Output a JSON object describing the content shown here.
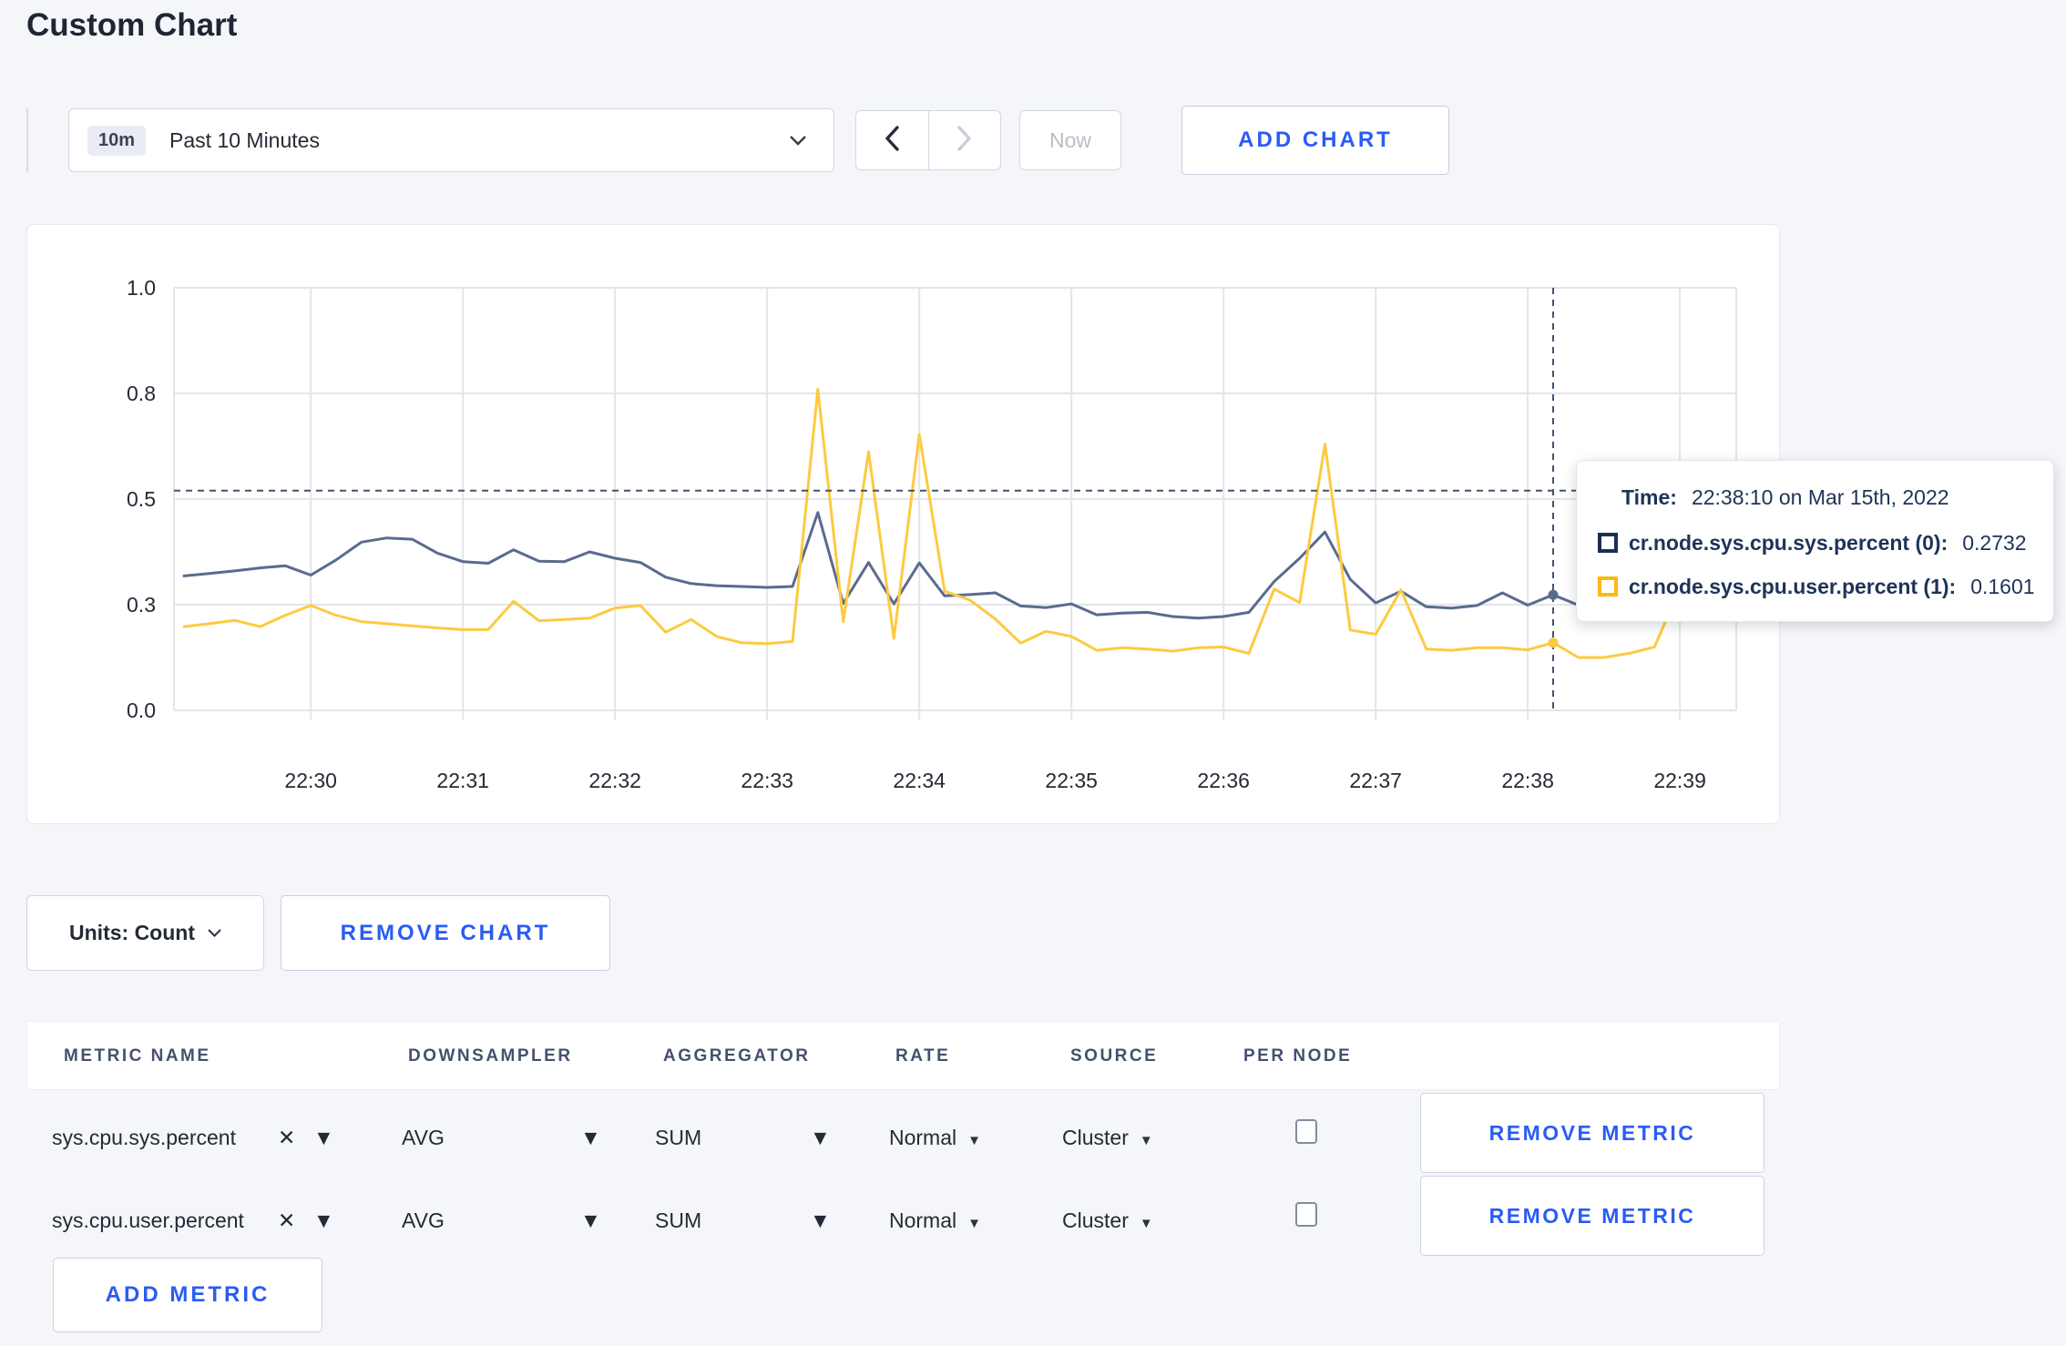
{
  "page": {
    "title": "Custom Chart",
    "background": "#f5f6fa",
    "accent_blue": "#2a5cf4"
  },
  "toolbar": {
    "time_range": {
      "badge": "10m",
      "label": "Past 10 Minutes"
    },
    "now_label": "Now",
    "add_chart_label": "ADD CHART"
  },
  "icons": {
    "close": "✕",
    "caret_down": "▼"
  },
  "chart_data": {
    "type": "line",
    "title": "",
    "xlabel": "",
    "ylabel": "",
    "ylim": [
      0,
      1
    ],
    "grid": true,
    "legend_position": "tooltip",
    "y_tick_values": [
      0,
      0.25,
      0.5,
      0.75,
      1.0
    ],
    "y_tick_labels": [
      "0.0",
      "0.3",
      "0.5",
      "0.8",
      "1.0"
    ],
    "x_tick_labels": [
      "22:30",
      "22:31",
      "22:32",
      "22:33",
      "22:34",
      "22:35",
      "22:36",
      "22:37",
      "22:38",
      "22:39"
    ],
    "x_start": "22:29:10",
    "x_step_seconds": 10,
    "series": [
      {
        "name": "cr.node.sys.cpu.sys.percent (0)",
        "color": "#5a6b8e",
        "values": [
          0.318,
          0.324,
          0.33,
          0.337,
          0.342,
          0.32,
          0.356,
          0.398,
          0.408,
          0.405,
          0.372,
          0.352,
          0.348,
          0.38,
          0.353,
          0.352,
          0.375,
          0.36,
          0.35,
          0.315,
          0.3,
          0.295,
          0.293,
          0.291,
          0.293,
          0.468,
          0.253,
          0.35,
          0.252,
          0.349,
          0.271,
          0.274,
          0.278,
          0.247,
          0.243,
          0.252,
          0.226,
          0.23,
          0.232,
          0.222,
          0.218,
          0.222,
          0.232,
          0.305,
          0.36,
          0.422,
          0.31,
          0.254,
          0.282,
          0.245,
          0.242,
          0.248,
          0.278,
          0.249,
          0.2732,
          0.249,
          0.262,
          0.279,
          0.253,
          0.255,
          0.315
        ]
      },
      {
        "name": "cr.node.sys.cpu.user.percent (1)",
        "color": "#fdca40",
        "values": [
          0.198,
          0.205,
          0.213,
          0.198,
          0.225,
          0.248,
          0.225,
          0.21,
          0.205,
          0.2,
          0.195,
          0.191,
          0.191,
          0.258,
          0.212,
          0.215,
          0.218,
          0.242,
          0.248,
          0.185,
          0.215,
          0.175,
          0.16,
          0.158,
          0.163,
          0.76,
          0.21,
          0.612,
          0.17,
          0.653,
          0.282,
          0.261,
          0.216,
          0.159,
          0.187,
          0.175,
          0.142,
          0.148,
          0.145,
          0.14,
          0.148,
          0.15,
          0.135,
          0.287,
          0.255,
          0.63,
          0.19,
          0.18,
          0.285,
          0.145,
          0.142,
          0.148,
          0.148,
          0.143,
          0.1601,
          0.125,
          0.125,
          0.135,
          0.15,
          0.29,
          0.235
        ]
      }
    ],
    "crosshair": {
      "time": "22:38:10",
      "x_index": 54,
      "y_value": 0.52,
      "color": "#41546e"
    }
  },
  "tooltip": {
    "time_label": "Time:",
    "time_value": "22:38:10 on Mar 15th, 2022",
    "rows": [
      {
        "label": "cr.node.sys.cpu.sys.percent (0):",
        "value": "0.2732",
        "color": "#1b2f4d"
      },
      {
        "label": "cr.node.sys.cpu.user.percent (1):",
        "value": "0.1601",
        "color": "#fdb814"
      }
    ]
  },
  "units_bar": {
    "units_label": "Units: Count",
    "remove_chart_label": "REMOVE CHART"
  },
  "metrics_table": {
    "headers": [
      "METRIC NAME",
      "DOWNSAMPLER",
      "AGGREGATOR",
      "RATE",
      "SOURCE",
      "PER NODE"
    ],
    "rows": [
      {
        "metric": "sys.cpu.sys.percent",
        "downsampler": "AVG",
        "aggregator": "SUM",
        "rate": "Normal",
        "source": "Cluster",
        "per_node": false,
        "remove_label": "REMOVE METRIC"
      },
      {
        "metric": "sys.cpu.user.percent",
        "downsampler": "AVG",
        "aggregator": "SUM",
        "rate": "Normal",
        "source": "Cluster",
        "per_node": false,
        "remove_label": "REMOVE METRIC"
      }
    ],
    "add_metric_label": "ADD METRIC"
  }
}
